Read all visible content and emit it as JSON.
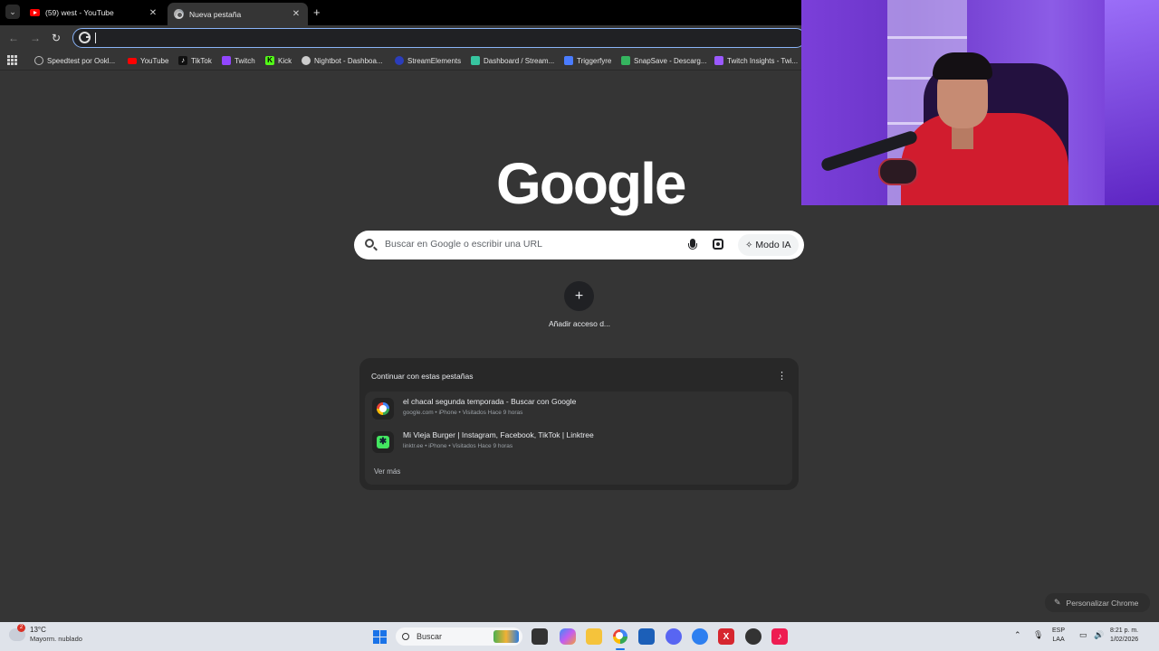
{
  "browser": {
    "tab_menu_icon": "chevron-down-icon",
    "tabs": [
      {
        "title": "(59) west - YouTube",
        "favicon": "youtube-icon",
        "active": false
      },
      {
        "title": "Nueva pestaña",
        "favicon": "chrome-icon",
        "active": true
      }
    ],
    "close_glyph": "✕",
    "new_tab_glyph": "+",
    "back_glyph": "←",
    "forward_glyph": "→",
    "reload_glyph": "↻",
    "omnibox_value": ""
  },
  "bookmarks": [
    {
      "label": "Speedtest por Ookl...",
      "icon": "speedtest-icon",
      "color": "#bbbbbb"
    },
    {
      "label": "YouTube",
      "icon": "youtube-icon",
      "color": "#ff0000"
    },
    {
      "label": "TikTok",
      "icon": "tiktok-icon",
      "color": "#111111"
    },
    {
      "label": "Twitch",
      "icon": "twitch-icon",
      "color": "#9146ff"
    },
    {
      "label": "Kick",
      "icon": "kick-icon",
      "color": "#53fc18"
    },
    {
      "label": "Nightbot - Dashboa...",
      "icon": "nightbot-icon",
      "color": "#cccccc"
    },
    {
      "label": "StreamElements",
      "icon": "streamelements-icon",
      "color": "#2b3dbb"
    },
    {
      "label": "Dashboard / Stream...",
      "icon": "dashboard-icon",
      "color": "#37c5a0"
    },
    {
      "label": "Triggerfyre",
      "icon": "triggerfyre-icon",
      "color": "#4a7cff"
    },
    {
      "label": "SnapSave - Descarg...",
      "icon": "snapsave-icon",
      "color": "#35b55f"
    },
    {
      "label": "Twitch Insights - Twi...",
      "icon": "twitch-insights-icon",
      "color": "#9b59ff"
    }
  ],
  "newtab": {
    "logo": "Google",
    "search_placeholder": "Buscar en Google o escribir una URL",
    "ai_mode_label": "Modo IA",
    "add_shortcut_label": "Añadir acceso d...",
    "continue_card": {
      "title": "Continuar con estas pestañas",
      "items": [
        {
          "title": "el chacal segunda temporada - Buscar con Google",
          "meta": "google.com • iPhone • Visitados Hace 9 horas",
          "icon": "google-icon"
        },
        {
          "title": "Mi Vieja Burger | Instagram, Facebook, TikTok | Linktree",
          "meta": "linktr.ee • iPhone • Visitados Hace 9 horas",
          "icon": "linktree-icon"
        }
      ],
      "more_label": "Ver más"
    },
    "customize_label": "Personalizar Chrome"
  },
  "taskbar": {
    "weather_temp": "13°C",
    "weather_condition": "Mayorm. nublado",
    "weather_badge": "2",
    "search_label": "Buscar",
    "lang_line1": "ESP",
    "lang_line2": "LAA",
    "time": "8:21 p. m.",
    "date": "1/02/2026"
  }
}
